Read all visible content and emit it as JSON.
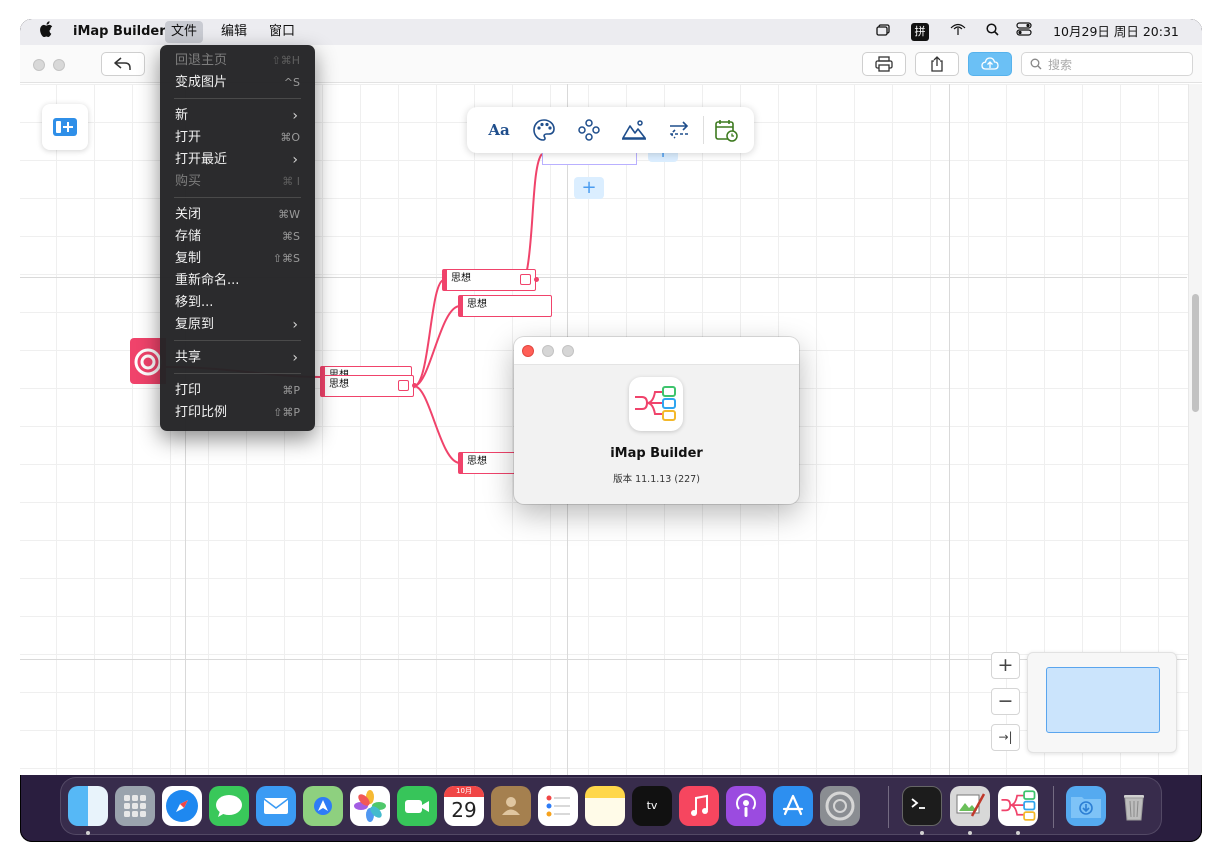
{
  "menubar": {
    "apple_icon": "apple-icon",
    "app_name": "iMap Builder",
    "menus": [
      "文件",
      "编辑",
      "窗口"
    ],
    "status": {
      "input_method": "拼",
      "clock": "10月29日 周日  20:31"
    }
  },
  "toolbar": {
    "search_placeholder": "搜索",
    "buttons": [
      "back-icon",
      "print-icon",
      "share-icon",
      "cloud-upload-icon"
    ]
  },
  "float_toolbar": {
    "font_label": "Aa",
    "tools": [
      "text-style-icon",
      "palette-icon",
      "layout-icon",
      "image-icon",
      "swap-icon",
      "calendar-icon"
    ]
  },
  "file_menu": {
    "items": [
      {
        "label": "回退主页",
        "shortcut": "⇧⌘H",
        "disabled": true
      },
      {
        "label": "变成图片",
        "shortcut": "^S",
        "disabled": false
      },
      {
        "label": "新",
        "submenu": true
      },
      {
        "label": "打开",
        "shortcut": "⌘O"
      },
      {
        "label": "打开最近",
        "submenu": true
      },
      {
        "label": "购买",
        "shortcut": "⌘ I",
        "disabled": true
      },
      {
        "label": "关闭",
        "shortcut": "⌘W"
      },
      {
        "label": "存储",
        "shortcut": "⌘S"
      },
      {
        "label": "复制",
        "shortcut": "⇧⌘S"
      },
      {
        "label": "重新命名..."
      },
      {
        "label": "移到..."
      },
      {
        "label": "复原到",
        "submenu": true
      },
      {
        "label": "共享",
        "submenu": true
      },
      {
        "label": "打印",
        "shortcut": "⌘P"
      },
      {
        "label": "打印比例",
        "shortcut": "⇧⌘P"
      }
    ],
    "arrow": "›"
  },
  "mindmap": {
    "nodes": [
      "思想",
      "思想",
      "思想",
      "思想",
      "思想"
    ],
    "partial_node": "思想",
    "add_label": "+"
  },
  "zoom": {
    "in": "+",
    "out": "−",
    "fit": "→|"
  },
  "about_dialog": {
    "app_name": "iMap Builder",
    "version": "版本 11.1.13 (227)"
  },
  "dock": {
    "apps": [
      "Finder",
      "Launchpad",
      "Safari",
      "Messages",
      "Mail",
      "Maps",
      "Photos",
      "FaceTime",
      "Calendar",
      "Contacts",
      "Reminders",
      "Notes",
      "TV",
      "Music",
      "Podcasts",
      "App Store",
      "System Settings",
      "Terminal",
      "Image Editor",
      "iMap Builder",
      "Downloads",
      "Trash"
    ],
    "calendar_month": "10月",
    "calendar_day": "29",
    "tv_label": "tv"
  },
  "colors": {
    "accent": "#f0436b",
    "selection_blue": "#4a9cf0",
    "menu_bg": "#242426"
  }
}
